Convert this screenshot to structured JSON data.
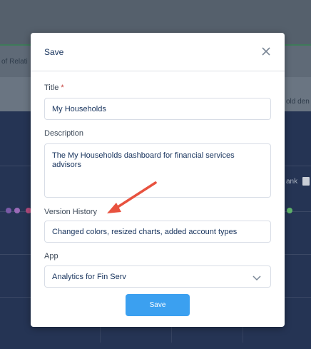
{
  "background": {
    "label_left": "of Relati",
    "label_right": "old den",
    "label_right2": "ank"
  },
  "modal": {
    "title": "Save",
    "close_icon": "close-icon",
    "fields": {
      "title_label": "Title",
      "required_marker": "*",
      "title_value": "My Households",
      "description_label": "Description",
      "description_value": "The My Households dashboard for financial services advisors",
      "version_label": "Version History",
      "version_value": "Changed colors, resized charts, added account types",
      "app_label": "App",
      "app_value": "Analytics for Fin Serv"
    },
    "save_label": "Save"
  },
  "annotation": {
    "arrow_color": "#e8523f"
  }
}
